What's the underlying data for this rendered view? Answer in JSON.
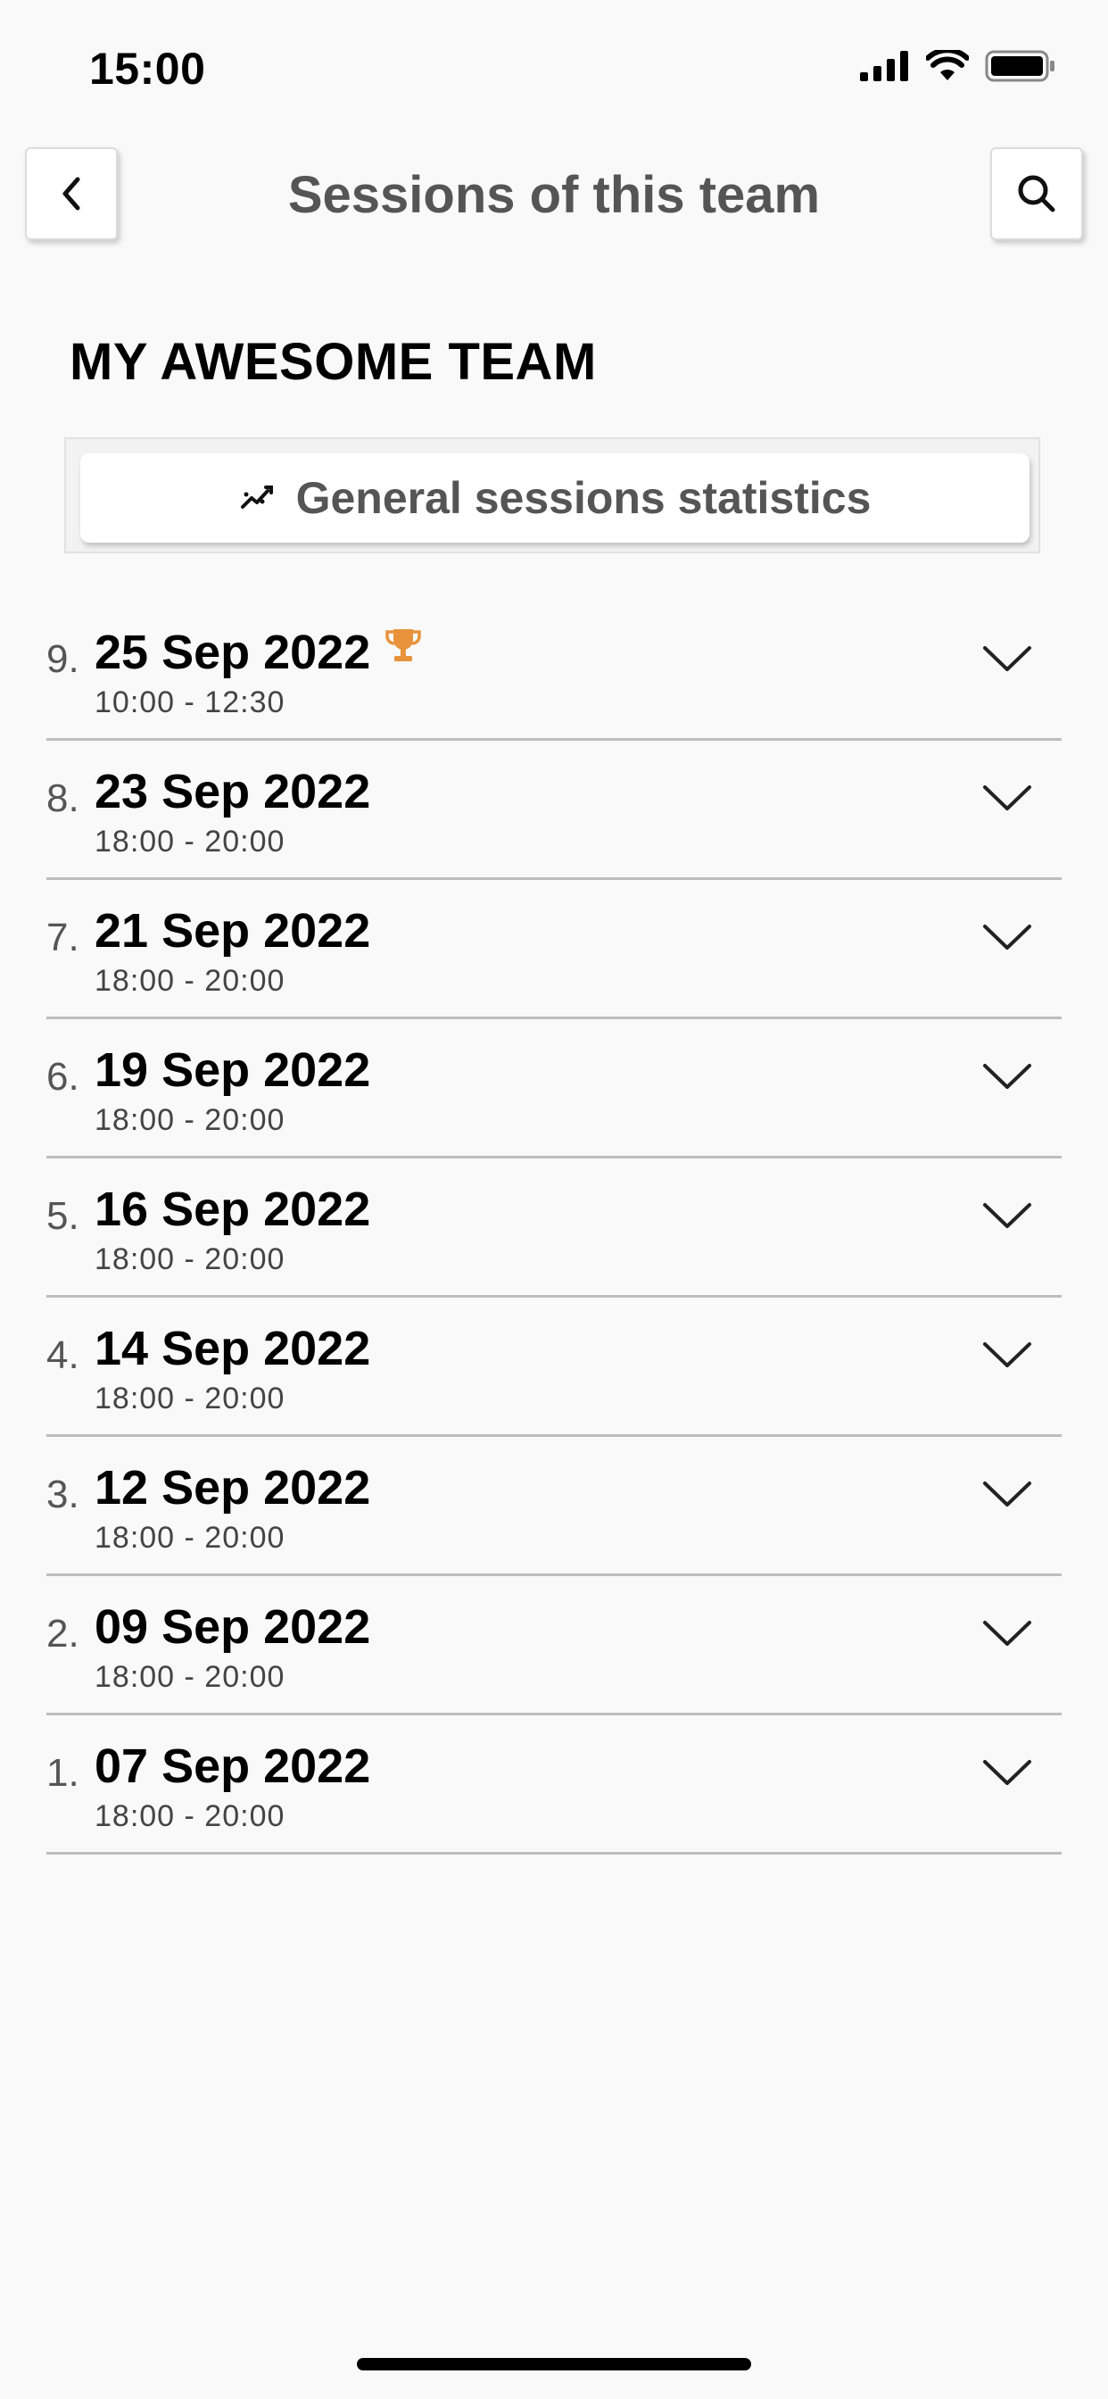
{
  "status_bar": {
    "time": "15:00",
    "icons": [
      "signal-icon",
      "wifi-icon",
      "battery-icon"
    ]
  },
  "header": {
    "title": "Sessions of this team",
    "back_icon": "chevron-left-icon",
    "search_icon": "search-icon"
  },
  "team": {
    "name": "MY AWESOME TEAM"
  },
  "stats_button": {
    "icon": "trend-chart-icon",
    "label": "General sessions statistics"
  },
  "colors": {
    "background": "#f9f9f9",
    "trophy": "#e8923b",
    "divider": "#bdbdbd",
    "muted_text": "#555555"
  },
  "sessions": [
    {
      "number": "9.",
      "date": "25 Sep 2022",
      "time": "10:00 - 12:30",
      "trophy": true
    },
    {
      "number": "8.",
      "date": "23 Sep 2022",
      "time": "18:00 - 20:00",
      "trophy": false
    },
    {
      "number": "7.",
      "date": "21 Sep 2022",
      "time": "18:00 - 20:00",
      "trophy": false
    },
    {
      "number": "6.",
      "date": "19 Sep 2022",
      "time": "18:00 - 20:00",
      "trophy": false
    },
    {
      "number": "5.",
      "date": "16 Sep 2022",
      "time": "18:00 - 20:00",
      "trophy": false
    },
    {
      "number": "4.",
      "date": "14 Sep 2022",
      "time": "18:00 - 20:00",
      "trophy": false
    },
    {
      "number": "3.",
      "date": "12 Sep 2022",
      "time": "18:00 - 20:00",
      "trophy": false
    },
    {
      "number": "2.",
      "date": "09 Sep 2022",
      "time": "18:00 - 20:00",
      "trophy": false
    },
    {
      "number": "1.",
      "date": "07 Sep 2022",
      "time": "18:00 - 20:00",
      "trophy": false
    }
  ]
}
